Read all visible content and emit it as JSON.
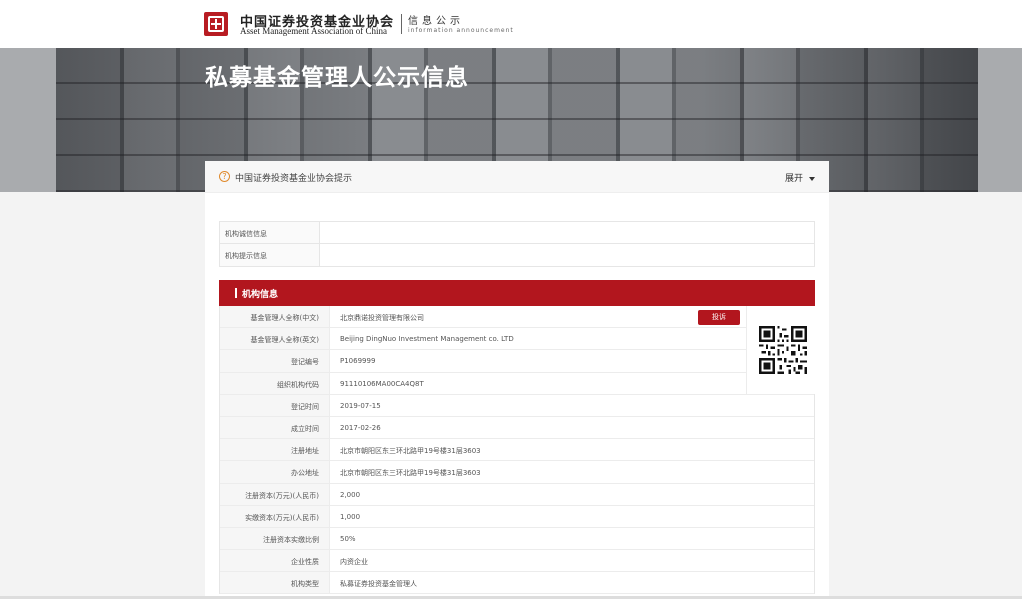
{
  "header": {
    "org_name_cn": "中国证券投资基金业协会",
    "org_name_en": "Asset Management Association of China",
    "section_cn": "信息公示",
    "section_en": "information announcement"
  },
  "banner": {
    "title": "私募基金管理人公示信息"
  },
  "notice": {
    "icon": "question-icon",
    "text": "中国证券投资基金业协会提示",
    "expand_label": "展开"
  },
  "info_rows": [
    {
      "label": "机构诚信信息",
      "value": ""
    },
    {
      "label": "机构提示信息",
      "value": ""
    }
  ],
  "section": {
    "title": "机构信息",
    "complaint_label": "投诉",
    "accent_color": "#b2161e"
  },
  "org_rows": [
    {
      "label": "基金管理人全称(中文)",
      "value": "北京鼎诺投资管理有限公司"
    },
    {
      "label": "基金管理人全称(英文)",
      "value": "Beijing DingNuo Investment Management co. LTD"
    },
    {
      "label": "登记编号",
      "value": "P1069999"
    },
    {
      "label": "组织机构代码",
      "value": "91110106MA00CA4Q8T"
    },
    {
      "label": "登记时间",
      "value": "2019-07-15"
    },
    {
      "label": "成立时间",
      "value": "2017-02-26"
    },
    {
      "label": "注册地址",
      "value": "北京市朝阳区东三环北路甲19号楼31层3603"
    },
    {
      "label": "办公地址",
      "value": "北京市朝阳区东三环北路甲19号楼31层3603"
    },
    {
      "label": "注册资本(万元)(人民币)",
      "value": "2,000"
    },
    {
      "label": "实缴资本(万元)(人民币)",
      "value": "1,000"
    },
    {
      "label": "注册资本实缴比例",
      "value": "50%"
    },
    {
      "label": "企业性质",
      "value": "内资企业"
    },
    {
      "label": "机构类型",
      "value": "私募证券投资基金管理人"
    }
  ]
}
